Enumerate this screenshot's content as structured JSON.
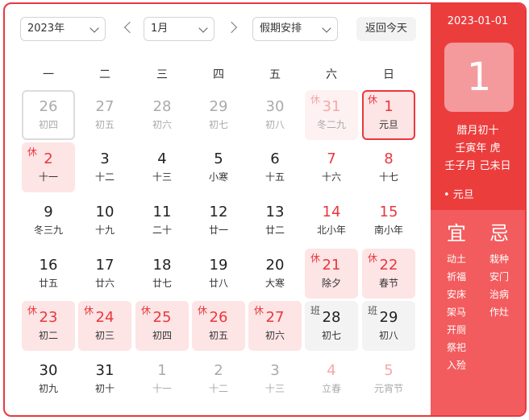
{
  "toolbar": {
    "year": "2023年",
    "month": "1月",
    "holiday_select": "假期安排",
    "today_button": "返回今天"
  },
  "weekdays": [
    "一",
    "二",
    "三",
    "四",
    "五",
    "六",
    "日"
  ],
  "days": [
    {
      "num": "26",
      "lunar": "初四",
      "tag": "",
      "kind": "other"
    },
    {
      "num": "27",
      "lunar": "初五",
      "tag": "",
      "kind": "other"
    },
    {
      "num": "28",
      "lunar": "初六",
      "tag": "",
      "kind": "other"
    },
    {
      "num": "29",
      "lunar": "初七",
      "tag": "",
      "kind": "other"
    },
    {
      "num": "30",
      "lunar": "初八",
      "tag": "",
      "kind": "other"
    },
    {
      "num": "31",
      "lunar": "冬二九",
      "tag": "休",
      "kind": "other-holiday"
    },
    {
      "num": "1",
      "lunar": "元旦",
      "tag": "休",
      "kind": "selected-holiday"
    },
    {
      "num": "2",
      "lunar": "十一",
      "tag": "休",
      "kind": "holiday"
    },
    {
      "num": "3",
      "lunar": "十二",
      "tag": "",
      "kind": "normal"
    },
    {
      "num": "4",
      "lunar": "十三",
      "tag": "",
      "kind": "normal"
    },
    {
      "num": "5",
      "lunar": "小寒",
      "tag": "",
      "kind": "normal"
    },
    {
      "num": "6",
      "lunar": "十五",
      "tag": "",
      "kind": "normal"
    },
    {
      "num": "7",
      "lunar": "十六",
      "tag": "",
      "kind": "weekend"
    },
    {
      "num": "8",
      "lunar": "十七",
      "tag": "",
      "kind": "weekend"
    },
    {
      "num": "9",
      "lunar": "冬三九",
      "tag": "",
      "kind": "normal"
    },
    {
      "num": "10",
      "lunar": "十九",
      "tag": "",
      "kind": "normal"
    },
    {
      "num": "11",
      "lunar": "二十",
      "tag": "",
      "kind": "normal"
    },
    {
      "num": "12",
      "lunar": "廿一",
      "tag": "",
      "kind": "normal"
    },
    {
      "num": "13",
      "lunar": "廿二",
      "tag": "",
      "kind": "normal"
    },
    {
      "num": "14",
      "lunar": "北小年",
      "tag": "",
      "kind": "weekend"
    },
    {
      "num": "15",
      "lunar": "南小年",
      "tag": "",
      "kind": "weekend"
    },
    {
      "num": "16",
      "lunar": "廿五",
      "tag": "",
      "kind": "normal"
    },
    {
      "num": "17",
      "lunar": "廿六",
      "tag": "",
      "kind": "normal"
    },
    {
      "num": "18",
      "lunar": "廿七",
      "tag": "",
      "kind": "normal"
    },
    {
      "num": "19",
      "lunar": "廿八",
      "tag": "",
      "kind": "normal"
    },
    {
      "num": "20",
      "lunar": "大寒",
      "tag": "",
      "kind": "normal"
    },
    {
      "num": "21",
      "lunar": "除夕",
      "tag": "休",
      "kind": "holiday"
    },
    {
      "num": "22",
      "lunar": "春节",
      "tag": "休",
      "kind": "holiday"
    },
    {
      "num": "23",
      "lunar": "初二",
      "tag": "休",
      "kind": "holiday"
    },
    {
      "num": "24",
      "lunar": "初三",
      "tag": "休",
      "kind": "holiday"
    },
    {
      "num": "25",
      "lunar": "初四",
      "tag": "休",
      "kind": "holiday"
    },
    {
      "num": "26",
      "lunar": "初五",
      "tag": "休",
      "kind": "holiday"
    },
    {
      "num": "27",
      "lunar": "初六",
      "tag": "休",
      "kind": "holiday"
    },
    {
      "num": "28",
      "lunar": "初七",
      "tag": "班",
      "kind": "workday"
    },
    {
      "num": "29",
      "lunar": "初八",
      "tag": "班",
      "kind": "workday"
    },
    {
      "num": "30",
      "lunar": "初九",
      "tag": "",
      "kind": "normal"
    },
    {
      "num": "31",
      "lunar": "初十",
      "tag": "",
      "kind": "normal"
    },
    {
      "num": "1",
      "lunar": "十一",
      "tag": "",
      "kind": "other"
    },
    {
      "num": "2",
      "lunar": "十二",
      "tag": "",
      "kind": "other"
    },
    {
      "num": "3",
      "lunar": "十三",
      "tag": "",
      "kind": "other"
    },
    {
      "num": "4",
      "lunar": "立春",
      "tag": "",
      "kind": "other-weekend"
    },
    {
      "num": "5",
      "lunar": "元宵节",
      "tag": "",
      "kind": "other-weekend"
    }
  ],
  "sidebar": {
    "date": "2023-01-01",
    "big_day": "1",
    "lunar_date": "腊月初十",
    "year_gz": "壬寅年 虎",
    "month_day_gz": "壬子月 己未日",
    "festival": "• 元旦",
    "yi_label": "宜",
    "ji_label": "忌",
    "yi_items": [
      "动土",
      "祈福",
      "安床",
      "架马",
      "开厕",
      "祭祀",
      "入殓"
    ],
    "ji_items": [
      "栽种",
      "安门",
      "治病",
      "作灶"
    ]
  },
  "colors": {
    "accent": "#e8383d",
    "holiday_bg": "#fde4e5",
    "workday_bg": "#f3f3f3",
    "sidebar_bg": "#ec3d3d",
    "sidebar_lower_bg": "#f25c5e"
  }
}
